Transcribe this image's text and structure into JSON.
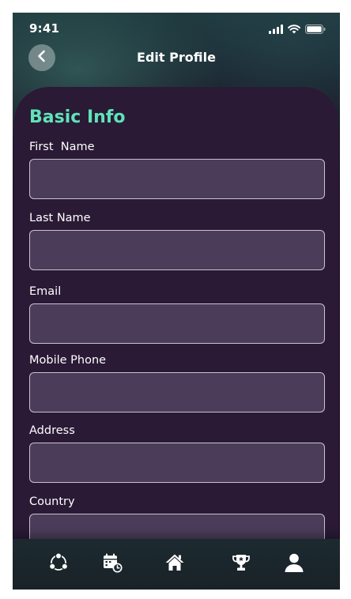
{
  "status_bar": {
    "time": "9:41",
    "icons": [
      "signal-icon",
      "wifi-icon",
      "battery-icon"
    ]
  },
  "header": {
    "title": "Edit Profile",
    "back_icon": "chevron-left-icon"
  },
  "form": {
    "section_title": "Basic Info",
    "fields": [
      {
        "label": "First  Name",
        "value": "",
        "placeholder": ""
      },
      {
        "label": "Last Name",
        "value": "",
        "placeholder": ""
      },
      {
        "label": "Email",
        "value": "",
        "placeholder": ""
      },
      {
        "label": "Mobile Phone",
        "value": "",
        "placeholder": ""
      },
      {
        "label": "Address",
        "value": "",
        "placeholder": ""
      },
      {
        "label": "Country",
        "value": "",
        "placeholder": ""
      }
    ]
  },
  "bottom_nav": {
    "items": [
      {
        "icon": "community-icon",
        "active": false
      },
      {
        "icon": "calendar-icon",
        "active": false
      },
      {
        "icon": "home-icon",
        "active": false
      },
      {
        "icon": "trophy-icon",
        "active": false
      },
      {
        "icon": "profile-icon",
        "active": true
      }
    ]
  },
  "colors": {
    "accent": "#5fe3b8",
    "card_background": "#2a1a35",
    "input_background": "#4b3d5a",
    "input_border": "#cbbfd6"
  }
}
